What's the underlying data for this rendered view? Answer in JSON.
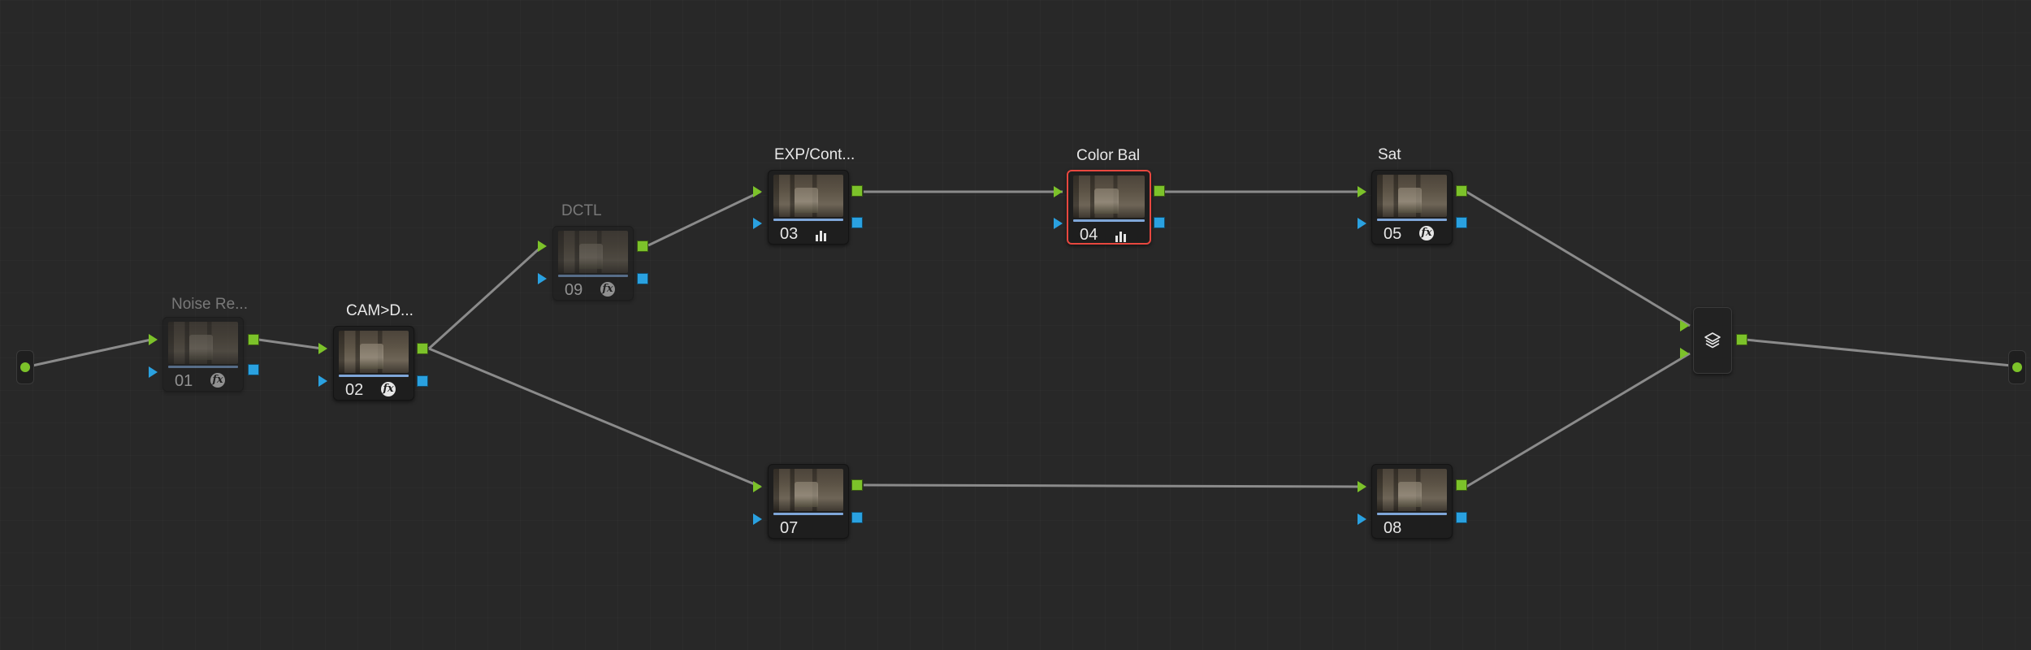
{
  "node_editor": {
    "nodes": [
      {
        "id": "01",
        "label": "Noise Re...",
        "icon": "fx-icon",
        "state": "disabled"
      },
      {
        "id": "02",
        "label": "CAM>D...",
        "icon": "fx-icon",
        "state": "enabled"
      },
      {
        "id": "09",
        "label": "DCTL",
        "icon": "fx-icon",
        "state": "disabled"
      },
      {
        "id": "03",
        "label": "EXP/Cont...",
        "icon": "bars-icon",
        "state": "enabled"
      },
      {
        "id": "04",
        "label": "Color Bal",
        "icon": "bars-icon",
        "state": "selected"
      },
      {
        "id": "05",
        "label": "Sat",
        "icon": "fx-icon",
        "state": "enabled"
      },
      {
        "id": "07",
        "label": "",
        "icon": "",
        "state": "enabled"
      },
      {
        "id": "08",
        "label": "",
        "icon": "",
        "state": "enabled"
      }
    ],
    "layer_mixer": {
      "icon": "layers-icon"
    },
    "source_input": {
      "icon": "input-dot-icon"
    },
    "output": {
      "icon": "output-dot-icon"
    },
    "colors": {
      "rgb_port": "#7cc22a",
      "key_port": "#2aa1e0",
      "selected_border": "#e8473f",
      "wire": "#8b8b8b",
      "background": "#282828"
    }
  }
}
